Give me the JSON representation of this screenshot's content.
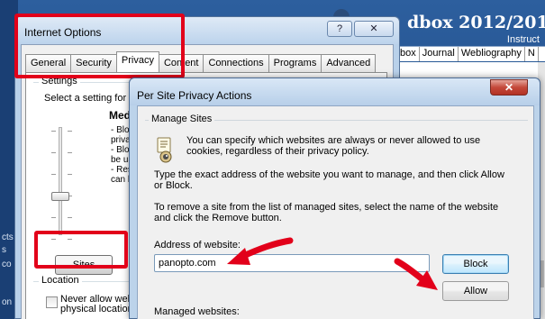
{
  "background_page": {
    "title": "dbox 2012/201",
    "subtitle": "Instruct",
    "nav_items": [
      "box",
      "Journal",
      "Webliography",
      "N"
    ],
    "left_fragments": [
      "cts",
      "s",
      "co",
      "on"
    ]
  },
  "internet_options": {
    "title": "Internet Options",
    "help_label": "?",
    "close_label": "✕",
    "tabs": [
      "General",
      "Security",
      "Privacy",
      "Content",
      "Connections",
      "Programs",
      "Advanced"
    ],
    "active_tab": "Privacy",
    "settings_label": "Settings",
    "select_text": "Select a setting for",
    "level_title": "Mediu",
    "level_desc_lines": [
      "- Bloc",
      "privac",
      "- Bloc",
      "be us",
      "- Res",
      "can b"
    ],
    "sites_button": "Sites",
    "location_label": "Location",
    "checkbox_line1": "Never allow webs",
    "checkbox_line2": "physical location"
  },
  "per_site": {
    "title": "Per Site Privacy Actions",
    "close_label": "✕",
    "group_label": "Manage Sites",
    "intro_line1": "You can specify which websites are always or never allowed to use",
    "intro_line2": "cookies, regardless of their privacy policy.",
    "instr1_line1": "Type the exact address of the website you want to manage, and then click Allow",
    "instr1_line2": "or Block.",
    "instr2_line1": "To remove a site from the list of managed sites, select the name of the website",
    "instr2_line2": "and click the Remove button.",
    "address_label": "Address of website:",
    "address_value": "panopto.com",
    "block_button": "Block",
    "allow_button": "Allow",
    "managed_label": "Managed websites:"
  },
  "colors": {
    "highlight": "#e2001a",
    "arrow": "#e2001a"
  },
  "icons": [
    "privacy-cookie-icon",
    "arrow-annotation"
  ]
}
